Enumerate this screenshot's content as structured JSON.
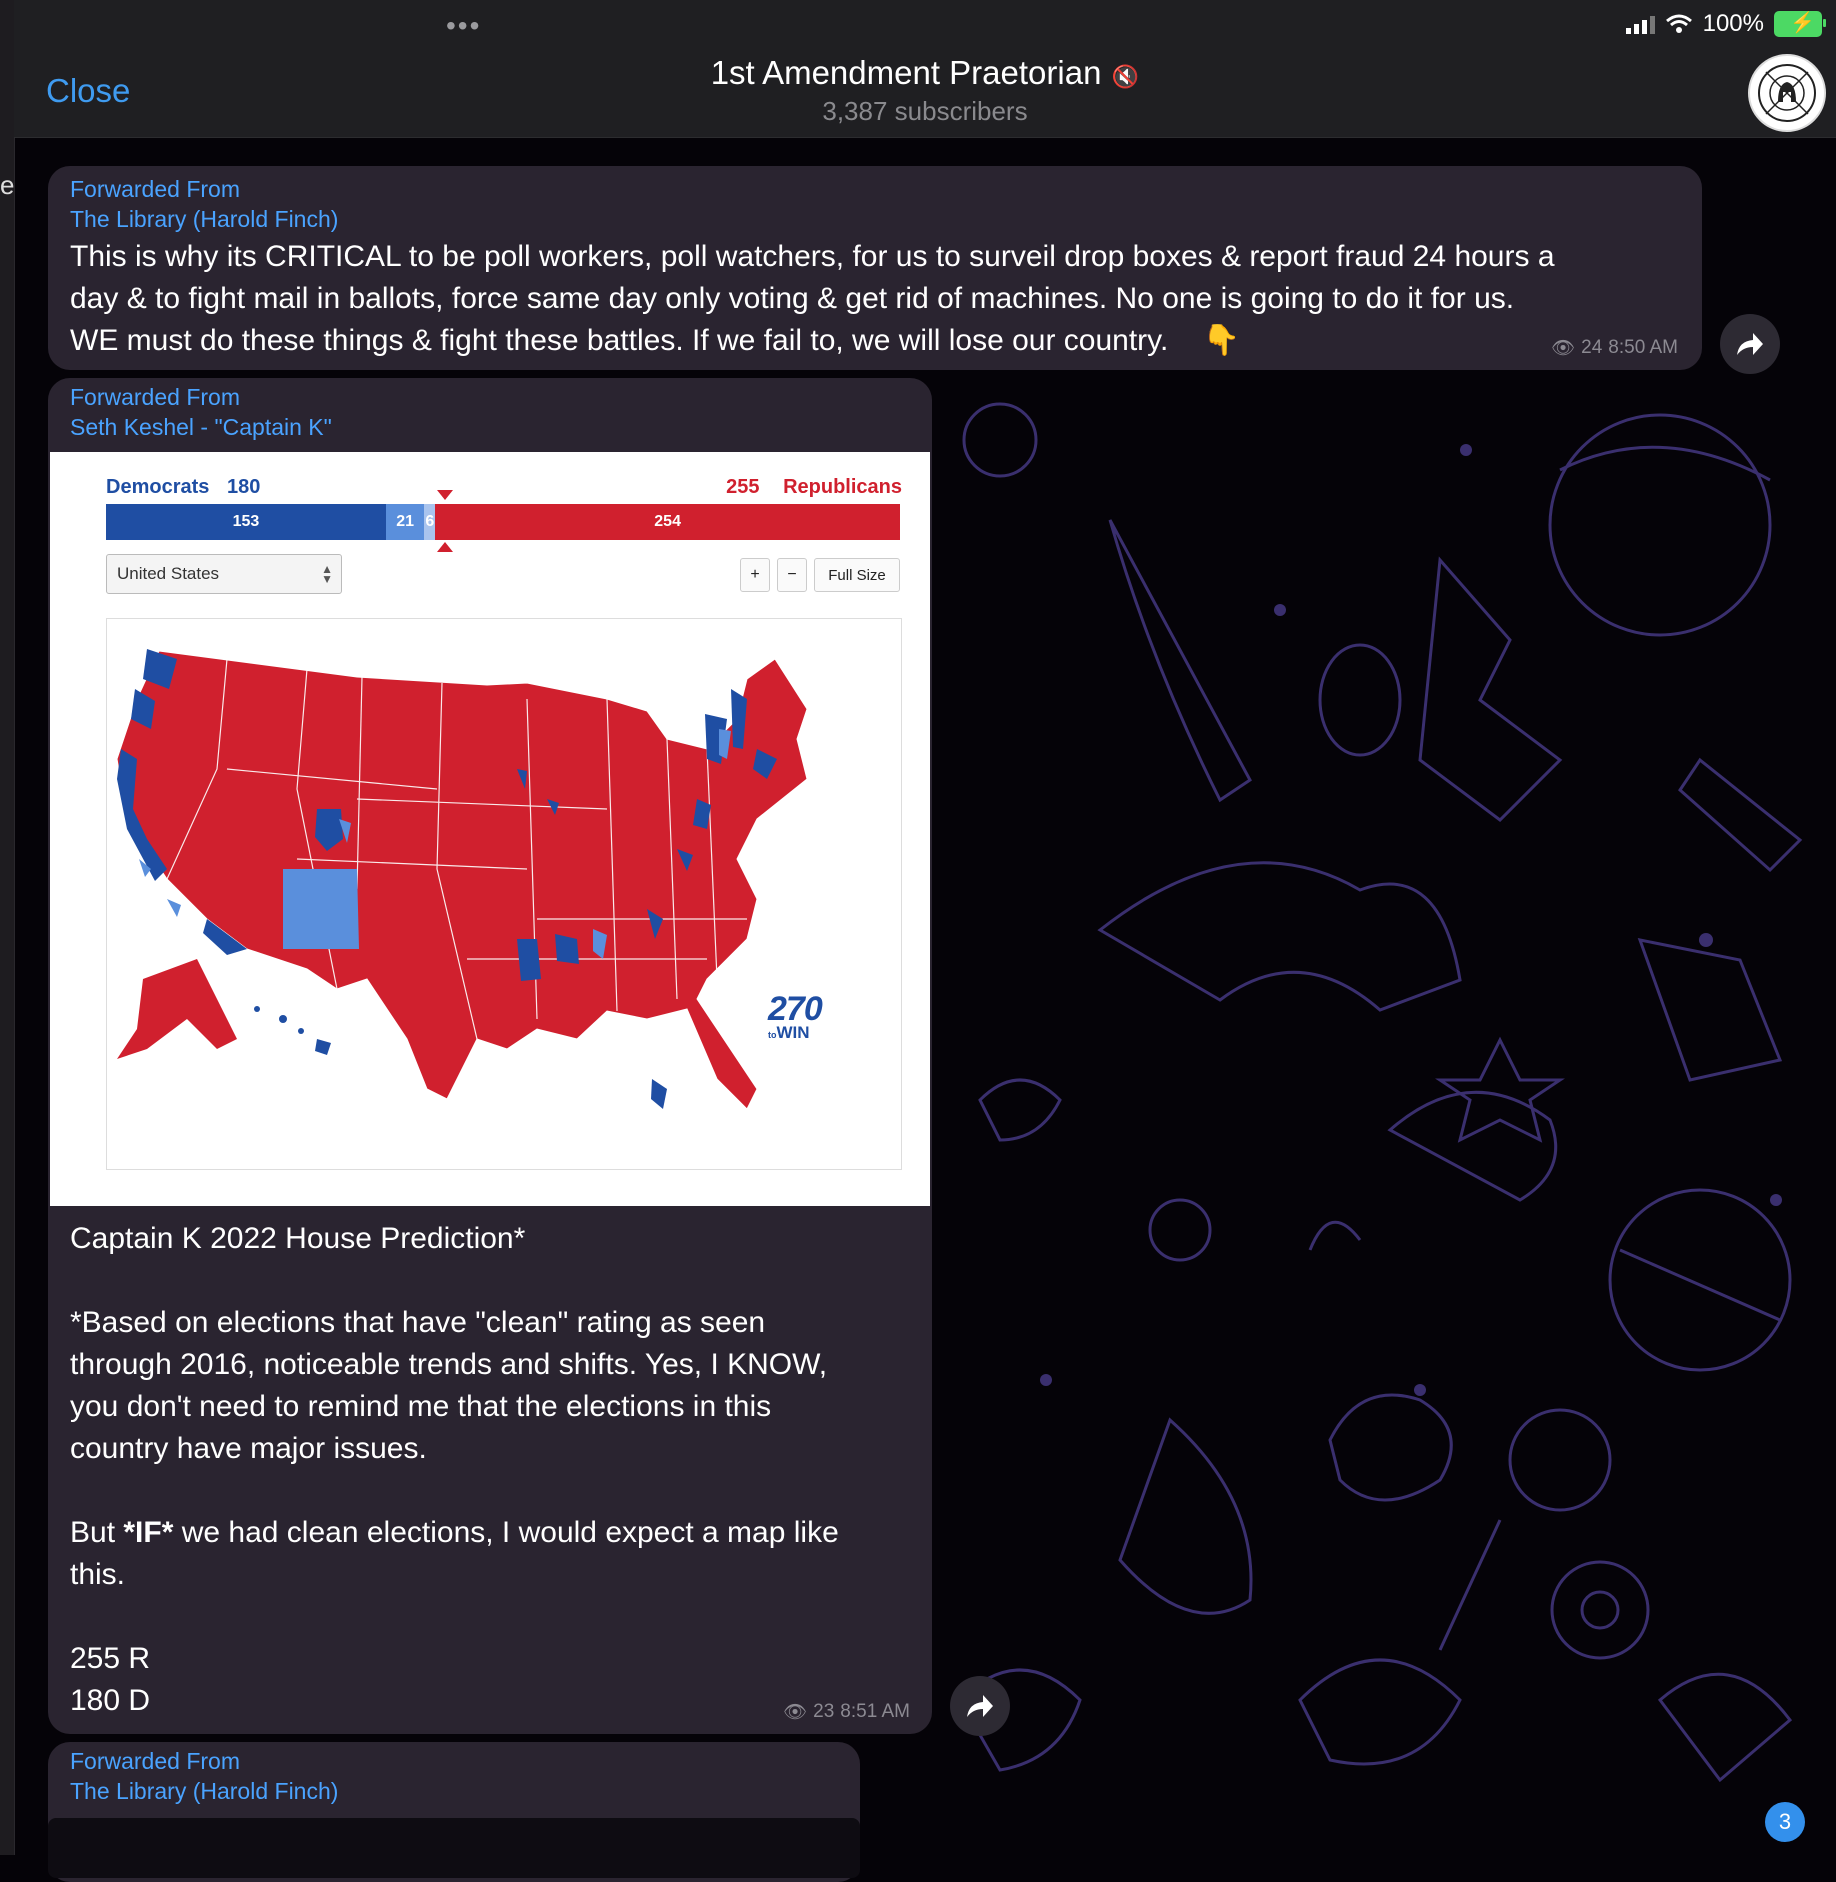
{
  "status_bar": {
    "battery": "100%",
    "colors": {
      "battery": "#4cd964"
    }
  },
  "header": {
    "close_label": "Close",
    "channel_title": "1st Amendment Praetorian",
    "subscribers": "3,387 subscribers",
    "avatar_icon": "helmet-logo-icon"
  },
  "sidebar_partial_letter": "e",
  "messages": [
    {
      "forwarded_label": "Forwarded From",
      "forwarded_name": "The Library (Harold Finch)",
      "text_lines": [
        "This is why its CRITICAL to be poll workers, poll watchers, for us to surveil drop boxes & report fraud 24 hours a",
        "day & to fight mail in ballots, force same day only voting & get rid of machines. No one is going to do it for us.",
        "WE must do these things & fight these battles. If we fail to, we will lose our country."
      ],
      "emoji": "👇",
      "views": "24",
      "time": "8:50 AM"
    },
    {
      "forwarded_label": "Forwarded From",
      "forwarded_name": "Seth Keshel - \"Captain K\"",
      "caption_title": "Captain K 2022 House Prediction*",
      "paragraph1_lines": [
        "*Based on elections that have \"clean\" rating as seen",
        "through 2016, noticeable trends and shifts.  Yes, I KNOW,",
        "you don't need to remind me that the elections in this",
        "country have major issues."
      ],
      "paragraph2_prefix": "But ",
      "paragraph2_bold": "*IF*",
      "paragraph2_line1_rest": " we had clean elections, I would expect a map like",
      "paragraph2_line2": "this.",
      "result_r": "255 R",
      "result_d": "180 D",
      "views": "23",
      "time": "8:51 AM"
    },
    {
      "forwarded_label": "Forwarded From",
      "forwarded_name": "The Library (Harold Finch)"
    }
  ],
  "chart_data": {
    "type": "map",
    "title": "",
    "region_selector": "United States",
    "controls": [
      "+",
      "−",
      "Full Size"
    ],
    "parties": [
      {
        "name": "Democrats",
        "total": 180,
        "color": "#1f4ea3"
      },
      {
        "name": "Republicans",
        "total": 255,
        "color": "#d0202e"
      }
    ],
    "tally_bar": [
      {
        "label": "153",
        "value": 153,
        "color": "#1f4ea3"
      },
      {
        "label": "21",
        "value": 21,
        "color": "#5a8fdc"
      },
      {
        "label": "6",
        "value": 6,
        "color": "#a9c4ee"
      },
      {
        "label": "254",
        "value": 254,
        "color": "#d0202e"
      }
    ],
    "brand": {
      "number": "270",
      "word": "WIN",
      "prefix": "to"
    }
  },
  "unread_badge": "3",
  "colors": {
    "accent": "#3f9bf0",
    "forward_link": "#4aa3ff",
    "bubble": "#2a2430",
    "background": "#050308"
  }
}
